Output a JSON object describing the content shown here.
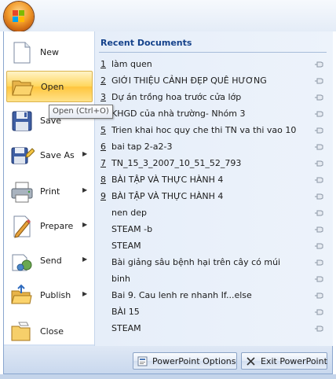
{
  "menu": {
    "items": [
      {
        "label": "New",
        "has_arrow": false,
        "icon": "new-document-icon"
      },
      {
        "label": "Open",
        "has_arrow": false,
        "icon": "open-folder-icon"
      },
      {
        "label": "Save",
        "has_arrow": false,
        "icon": "save-disk-icon"
      },
      {
        "label": "Save As",
        "has_arrow": true,
        "icon": "save-as-icon"
      },
      {
        "label": "Print",
        "has_arrow": true,
        "icon": "printer-icon"
      },
      {
        "label": "Prepare",
        "has_arrow": true,
        "icon": "prepare-document-icon"
      },
      {
        "label": "Send",
        "has_arrow": true,
        "icon": "send-icon"
      },
      {
        "label": "Publish",
        "has_arrow": true,
        "icon": "publish-icon"
      },
      {
        "label": "Close",
        "has_arrow": false,
        "icon": "close-folder-icon"
      }
    ],
    "selected": "Open",
    "tooltip": "Open (Ctrl+O)"
  },
  "recent": {
    "title": "Recent Documents",
    "documents": [
      {
        "num": "1",
        "name": "làm quen"
      },
      {
        "num": "2",
        "name": "GIỚI THIỆU CẢNH ĐẸP QUÊ HƯƠNG"
      },
      {
        "num": "3",
        "name": "Dự án trồng hoa trước cửa lớp"
      },
      {
        "num": "4",
        "name": "KHGD của nhà trường- Nhóm 3"
      },
      {
        "num": "5",
        "name": "Trien khai hoc quy che thi TN va thi vao 10"
      },
      {
        "num": "6",
        "name": "bai tap 2-a2-3"
      },
      {
        "num": "7",
        "name": "TN_15_3_2007_10_51_52_793"
      },
      {
        "num": "8",
        "name": "BÀI TẬP VÀ THỰC HÀNH 4"
      },
      {
        "num": "9",
        "name": "BÀI TẬP VÀ THỰC HÀNH 4"
      },
      {
        "num": "",
        "name": "nen dep"
      },
      {
        "num": "",
        "name": "STEAM -b"
      },
      {
        "num": "",
        "name": "STEAM"
      },
      {
        "num": "",
        "name": "Bài giảng sâu bệnh hại trên cây có múi"
      },
      {
        "num": "",
        "name": "binh"
      },
      {
        "num": "",
        "name": "Bai 9. Cau lenh re nhanh If...else"
      },
      {
        "num": "",
        "name": "BÀI 15"
      },
      {
        "num": "",
        "name": "STEAM"
      }
    ]
  },
  "footer": {
    "options_label": "PowerPoint Options",
    "exit_label": "Exit PowerPoint"
  }
}
